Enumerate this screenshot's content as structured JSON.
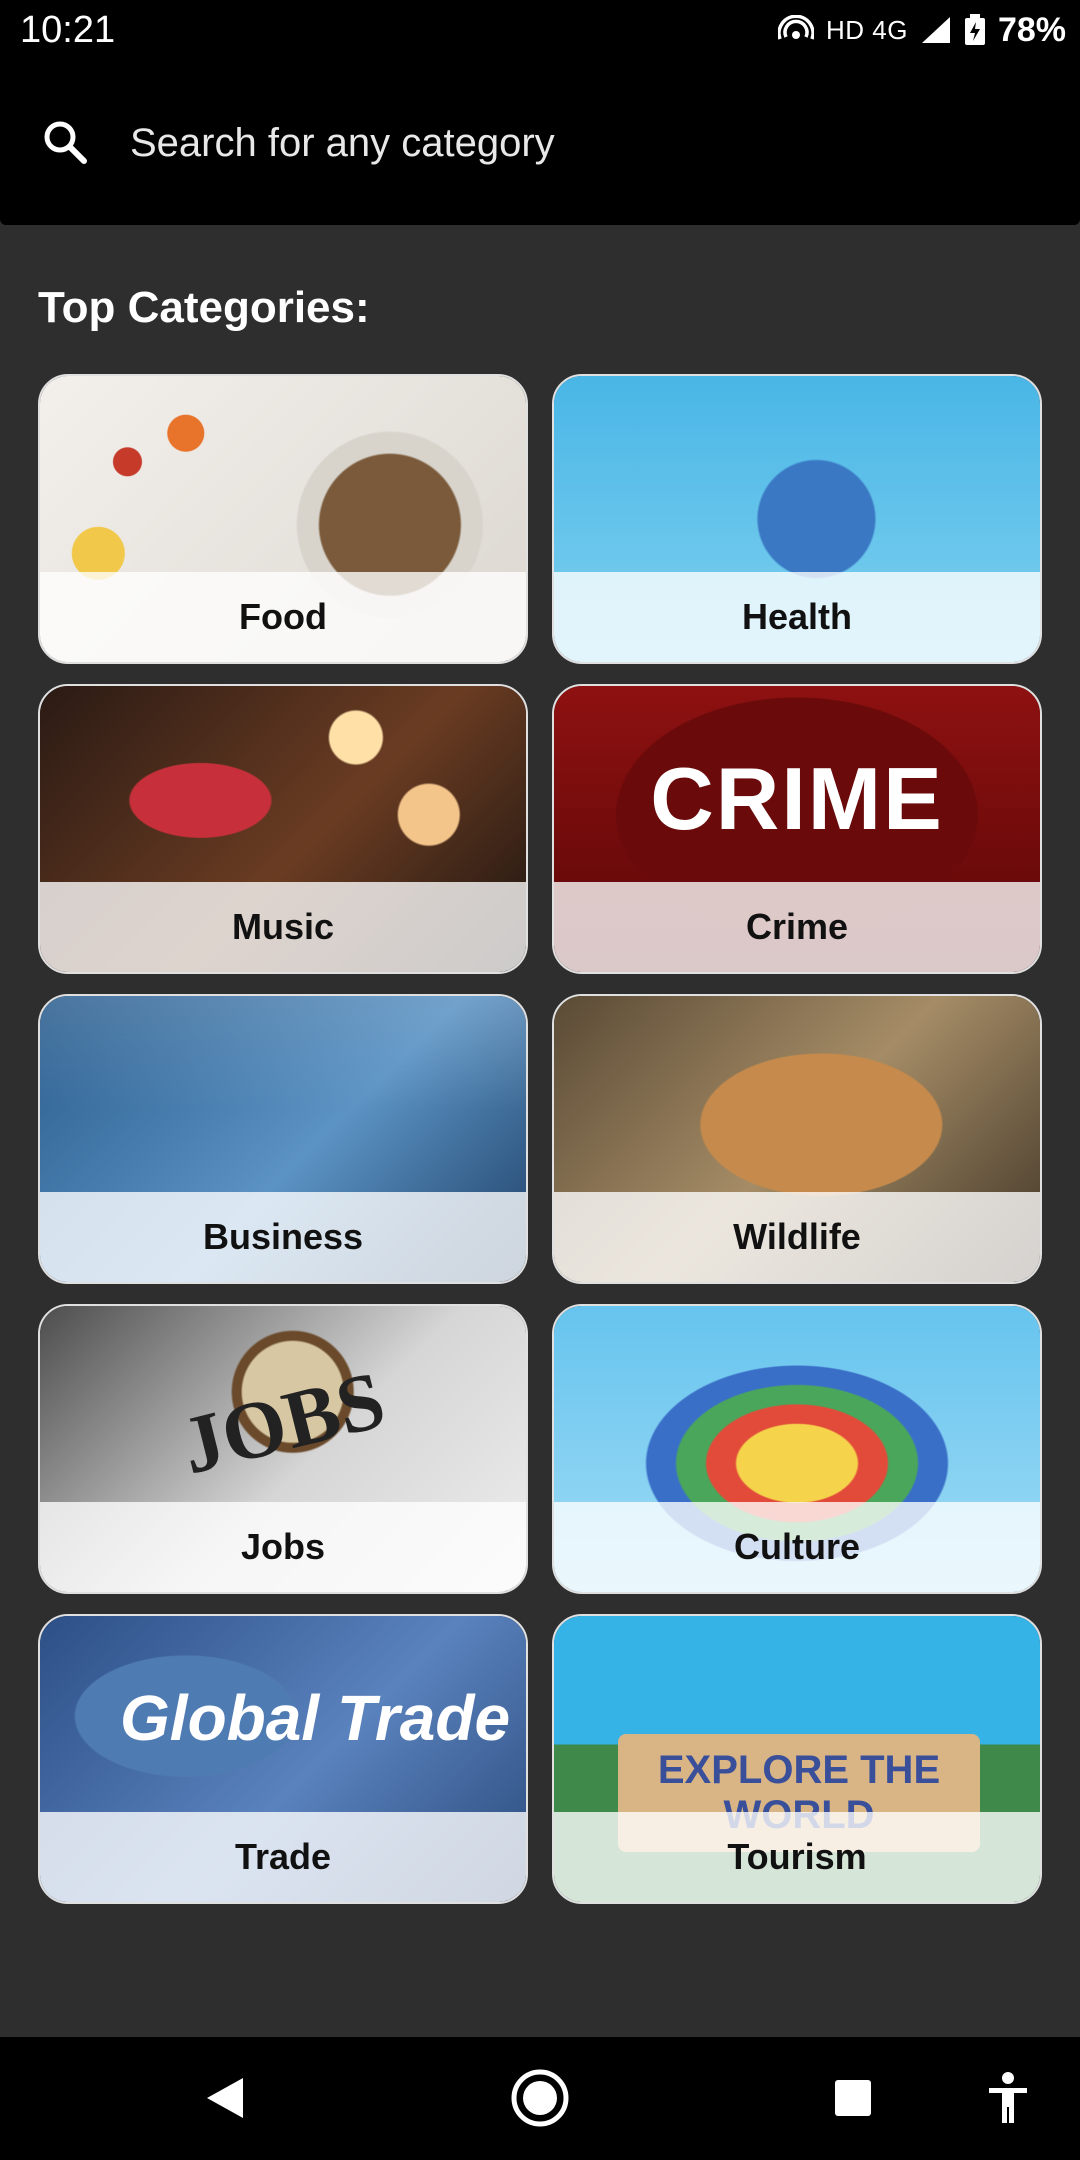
{
  "status_bar": {
    "time": "10:21",
    "network": "HD 4G",
    "battery": "78%"
  },
  "search": {
    "placeholder": "Search for any category"
  },
  "section_title": "Top Categories:",
  "categories": [
    {
      "label": "Food",
      "icon": "food-image"
    },
    {
      "label": "Health",
      "icon": "health-image"
    },
    {
      "label": "Music",
      "icon": "music-image"
    },
    {
      "label": "Crime",
      "icon": "crime-image",
      "image_text": "CRIME"
    },
    {
      "label": "Business",
      "icon": "business-image"
    },
    {
      "label": "Wildlife",
      "icon": "wildlife-image"
    },
    {
      "label": "Jobs",
      "icon": "jobs-image",
      "image_text": "JOBS"
    },
    {
      "label": "Culture",
      "icon": "culture-image"
    },
    {
      "label": "Trade",
      "icon": "trade-image",
      "image_text": "Global Trade"
    },
    {
      "label": "Tourism",
      "icon": "tourism-image",
      "image_text": "EXPLORE THE WORLD"
    }
  ],
  "nav": {
    "back": "back-icon",
    "home": "home-icon",
    "recents": "recents-icon",
    "accessibility": "accessibility-icon"
  },
  "colors": {
    "background": "#2e2e2e",
    "bars": "#000000",
    "card_label_band": "#ffffffc7"
  }
}
